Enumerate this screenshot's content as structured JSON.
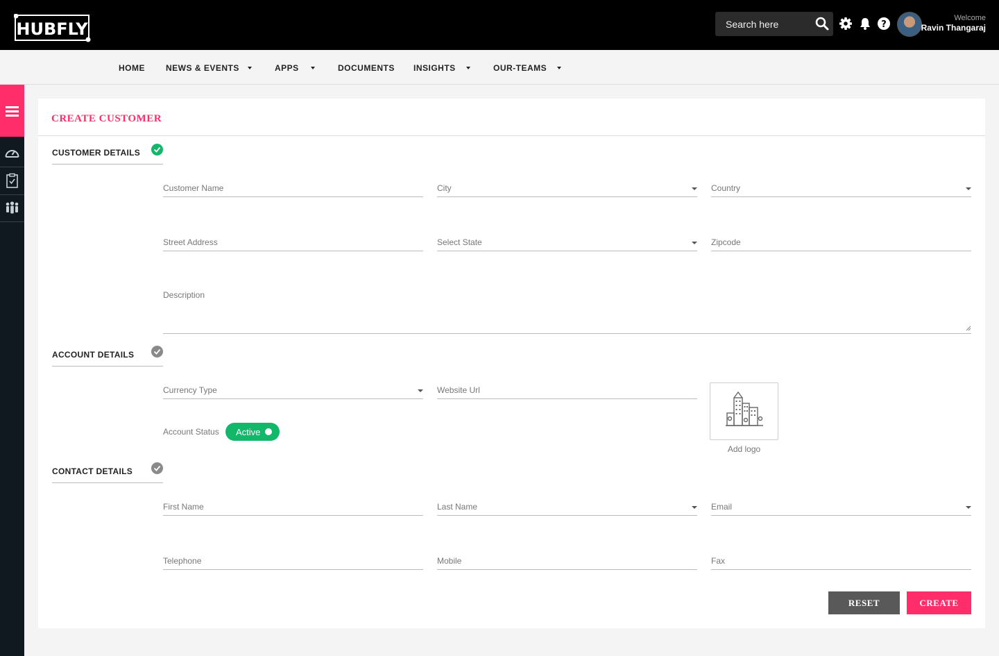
{
  "header": {
    "logo_text": "HUBFLY",
    "search_placeholder": "Search here",
    "welcome": "Welcome",
    "user_name": "Ravin Thangaraj"
  },
  "nav": {
    "home": "HOME",
    "news": "NEWS & EVENTS",
    "apps": "APPS",
    "documents": "DOCUMENTS",
    "insights": "INSIGHTS",
    "teams": "OUR-TEAMS"
  },
  "form": {
    "title": "CREATE CUSTOMER",
    "customer_section": "CUSTOMER DETAILS",
    "account_section": "ACCOUNT DETAILS",
    "contact_section": "CONTACT DETAILS",
    "customer_name": "Customer Name",
    "city": "City",
    "country": "Country",
    "street_address": "Street Address",
    "select_state": "Select State",
    "zipcode": "Zipcode",
    "description": "Description",
    "currency_type": "Currency Type",
    "website_url": "Website Url",
    "account_status": "Account Status",
    "status_value": "Active",
    "add_logo": "Add logo",
    "first_name": "First Name",
    "last_name": "Last Name",
    "email": "Email",
    "telephone": "Telephone",
    "mobile": "Mobile",
    "fax": "Fax",
    "reset": "RESET",
    "create": "CREATE"
  },
  "colors": {
    "accent": "#ff2d6a",
    "success": "#12b76a",
    "topbar": "#000000",
    "sidebar": "#101820"
  },
  "icons": [
    "search-icon",
    "gear-icon",
    "bell-icon",
    "help-icon",
    "menu-icon",
    "dashboard-icon",
    "clipboard-icon",
    "team-icon",
    "check-icon",
    "building-icon"
  ]
}
